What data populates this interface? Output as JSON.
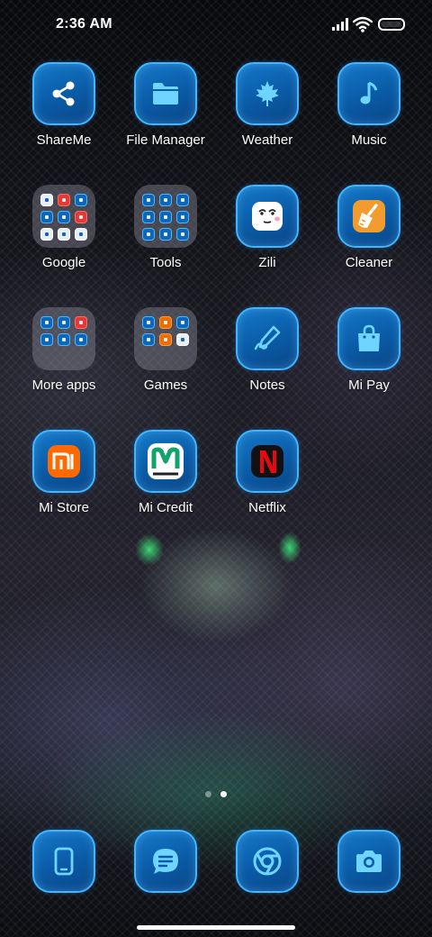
{
  "status_bar": {
    "time": "2:36 AM"
  },
  "apps": [
    {
      "label": "ShareMe",
      "icon": "share-icon"
    },
    {
      "label": "File Manager",
      "icon": "folder-icon"
    },
    {
      "label": "Weather",
      "icon": "maple-leaf-icon"
    },
    {
      "label": "Music",
      "icon": "music-note-icon"
    },
    {
      "label": "Google",
      "icon": "folder-google"
    },
    {
      "label": "Tools",
      "icon": "folder-tools"
    },
    {
      "label": "Zili",
      "icon": "zili-face-icon"
    },
    {
      "label": "Cleaner",
      "icon": "broom-icon"
    },
    {
      "label": "More apps",
      "icon": "folder-more-apps"
    },
    {
      "label": "Games",
      "icon": "folder-games"
    },
    {
      "label": "Notes",
      "icon": "pen-note-icon"
    },
    {
      "label": "Mi Pay",
      "icon": "shopping-bag-icon"
    },
    {
      "label": "Mi Store",
      "icon": "mi-logo-icon"
    },
    {
      "label": "Mi Credit",
      "icon": "mi-credit-logo-icon"
    },
    {
      "label": "Netflix",
      "icon": "netflix-logo-icon"
    }
  ],
  "dock": [
    {
      "icon": "phone-icon"
    },
    {
      "icon": "messages-icon"
    },
    {
      "icon": "browser-icon"
    },
    {
      "icon": "camera-icon"
    }
  ],
  "pages": {
    "count": 2,
    "active": 2
  },
  "colors": {
    "accent": "#3fb6ff",
    "tile": "#0a5aa5",
    "netflix": "#e50914",
    "mi_orange": "#ff6900"
  }
}
